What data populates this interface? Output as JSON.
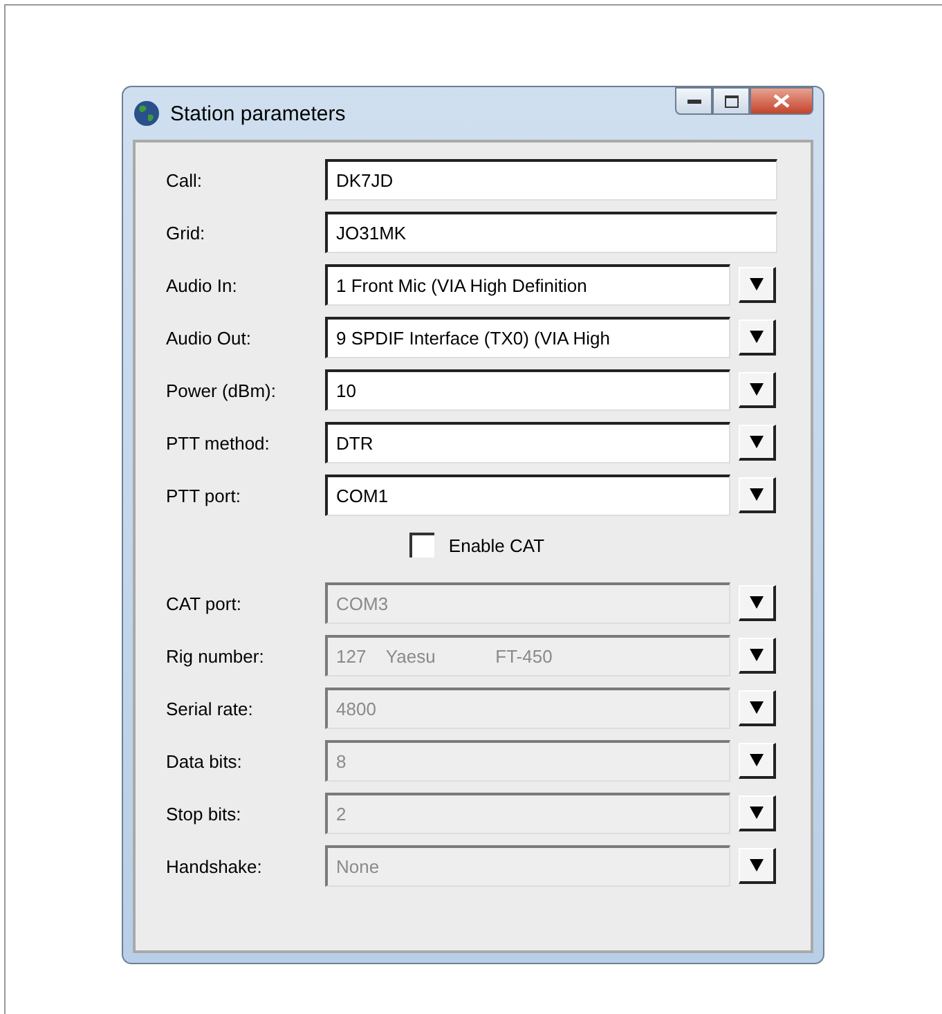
{
  "window": {
    "title": "Station parameters"
  },
  "fields": [
    {
      "label": "Call:",
      "value": "DK7JD",
      "kind": "text",
      "disabled": false
    },
    {
      "label": "Grid:",
      "value": "JO31MK",
      "kind": "text",
      "disabled": false
    },
    {
      "label": "Audio In:",
      "value": "1 Front Mic (VIA High Definition",
      "kind": "combo",
      "disabled": false
    },
    {
      "label": "Audio Out:",
      "value": "9 SPDIF Interface (TX0) (VIA High",
      "kind": "combo",
      "disabled": false
    },
    {
      "label": "Power (dBm):",
      "value": "10",
      "kind": "combo",
      "disabled": false
    },
    {
      "label": "PTT method:",
      "value": "DTR",
      "kind": "combo",
      "disabled": false
    },
    {
      "label": "PTT port:",
      "value": "COM1",
      "kind": "combo",
      "disabled": false
    }
  ],
  "enable_cat": {
    "label": "Enable CAT",
    "checked": false
  },
  "cat_fields": [
    {
      "label": "CAT port:",
      "value": "COM3",
      "kind": "combo",
      "disabled": true
    },
    {
      "label": "Rig number:",
      "value": "127    Yaesu            FT-450",
      "kind": "combo",
      "disabled": true
    },
    {
      "label": "Serial rate:",
      "value": "4800",
      "kind": "combo",
      "disabled": true
    },
    {
      "label": "Data bits:",
      "value": "8",
      "kind": "combo",
      "disabled": true
    },
    {
      "label": "Stop bits:",
      "value": "2",
      "kind": "combo",
      "disabled": true
    },
    {
      "label": "Handshake:",
      "value": "None",
      "kind": "combo",
      "disabled": true
    }
  ]
}
